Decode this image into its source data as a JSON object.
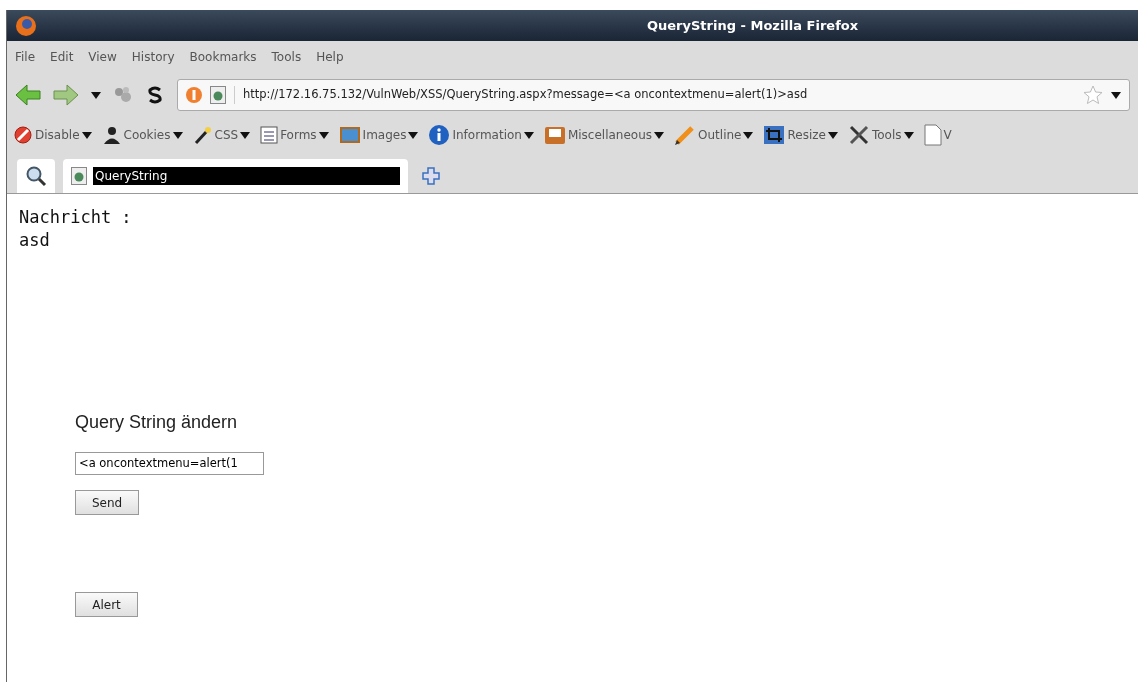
{
  "window": {
    "title": "QueryString - Mozilla Firefox"
  },
  "menu": [
    "File",
    "Edit",
    "View",
    "History",
    "Bookmarks",
    "Tools",
    "Help"
  ],
  "address_bar": {
    "url": "http://172.16.75.132/VulnWeb/XSS/QueryString.aspx?message=<a oncontextmenu=alert(1)>asd"
  },
  "dev_toolbar": [
    "Disable",
    "Cookies",
    "CSS",
    "Forms",
    "Images",
    "Information",
    "Miscellaneous",
    "Outline",
    "Resize",
    "Tools",
    "V"
  ],
  "tabs": [
    {
      "label": "QueryString",
      "selected": true
    }
  ],
  "page": {
    "message_label": "Nachricht :",
    "message_value": "asd",
    "heading": "Query String ändern",
    "query_field": {
      "value": "<a oncontextmenu=alert(1"
    },
    "send_button": "Send",
    "alert_button": "Alert"
  }
}
